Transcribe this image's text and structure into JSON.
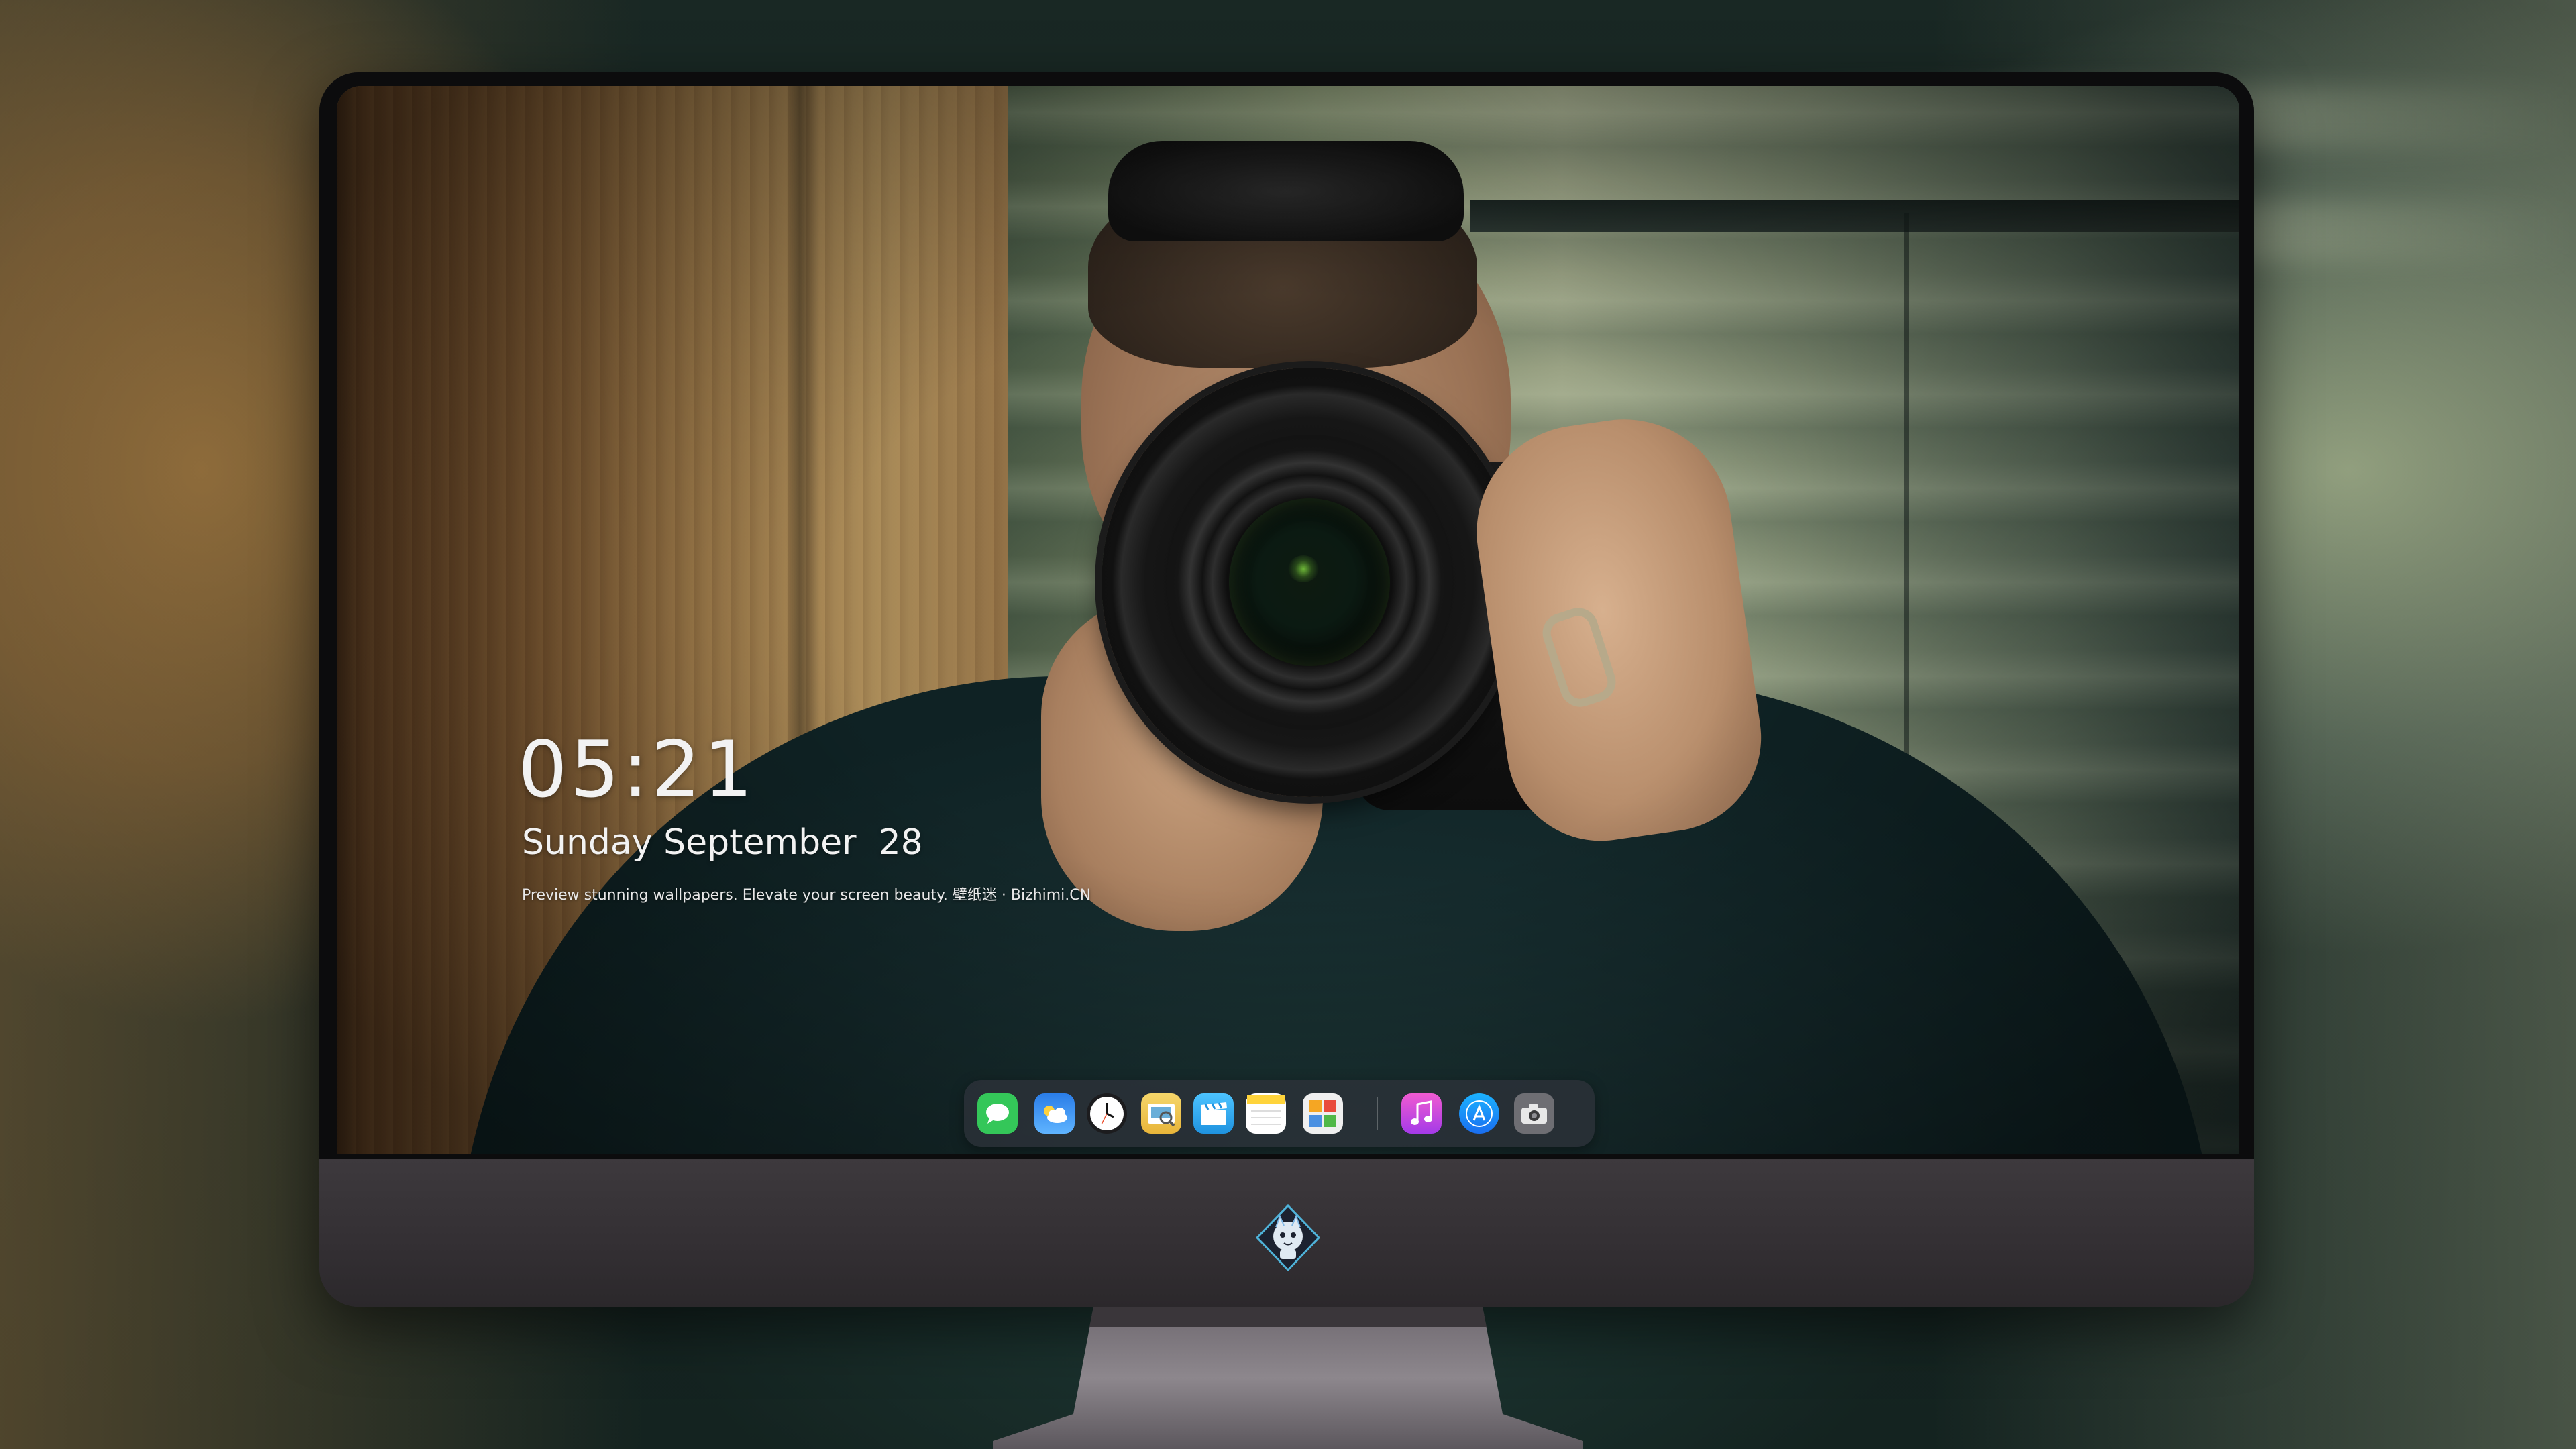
{
  "lock_screen": {
    "time": "05:21",
    "date": "Sunday September  28",
    "tagline": "Preview stunning wallpapers. Elevate your screen beauty. 壁纸迷 · Bizhimi.CN"
  },
  "dock": {
    "apps": [
      {
        "name": "Messages",
        "icon": "messages-icon",
        "color": "#34c759"
      },
      {
        "name": "Weather",
        "icon": "weather-icon",
        "color": "#2f8cf0"
      },
      {
        "name": "Clock",
        "icon": "clock-icon",
        "color": "#ffffff"
      },
      {
        "name": "Preview",
        "icon": "preview-icon",
        "color": "#f3c64a"
      },
      {
        "name": "Clips",
        "icon": "clapperboard-icon",
        "color": "#34a5e8"
      },
      {
        "name": "Notes",
        "icon": "notes-icon",
        "color": "#ffd43b"
      },
      {
        "name": "Photo Booth",
        "icon": "photo-grid-icon",
        "color": "#e8e8e8"
      },
      {
        "name": "Music",
        "icon": "music-icon",
        "color": "#c846e8"
      },
      {
        "name": "App Store",
        "icon": "app-store-icon",
        "color": "#1e8ef2"
      },
      {
        "name": "Screenshot",
        "icon": "camera-icon",
        "color": "#6e6e73"
      }
    ]
  },
  "theme": {
    "monitor_body": "#2e2c2f",
    "bezel": "#0c0c0d",
    "dock_background": "rgba(45,50,58,0.78)"
  }
}
